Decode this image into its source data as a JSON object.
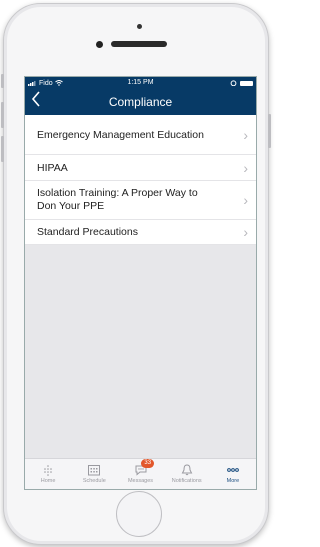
{
  "status_bar": {
    "carrier": "Fido",
    "time": "1:15 PM"
  },
  "header": {
    "title": "Compliance",
    "back_icon": "chevron-left-icon"
  },
  "list": {
    "items": [
      {
        "label": "Emergency Management Education"
      },
      {
        "label": "HIPAA"
      },
      {
        "label": "Isolation Training: A Proper Way to Don Your PPE"
      },
      {
        "label": "Standard Precautions"
      }
    ]
  },
  "tabbar": {
    "tabs": [
      {
        "label": "Home",
        "icon": "home-icon"
      },
      {
        "label": "Schedule",
        "icon": "calendar-icon"
      },
      {
        "label": "Messages",
        "icon": "chat-icon",
        "badge": "33"
      },
      {
        "label": "Notifications",
        "icon": "bell-icon"
      },
      {
        "label": "More",
        "icon": "more-icon",
        "active": true
      }
    ]
  },
  "colors": {
    "header": "#073a66",
    "badge": "#e2572b",
    "active_tab": "#1c4e80"
  }
}
